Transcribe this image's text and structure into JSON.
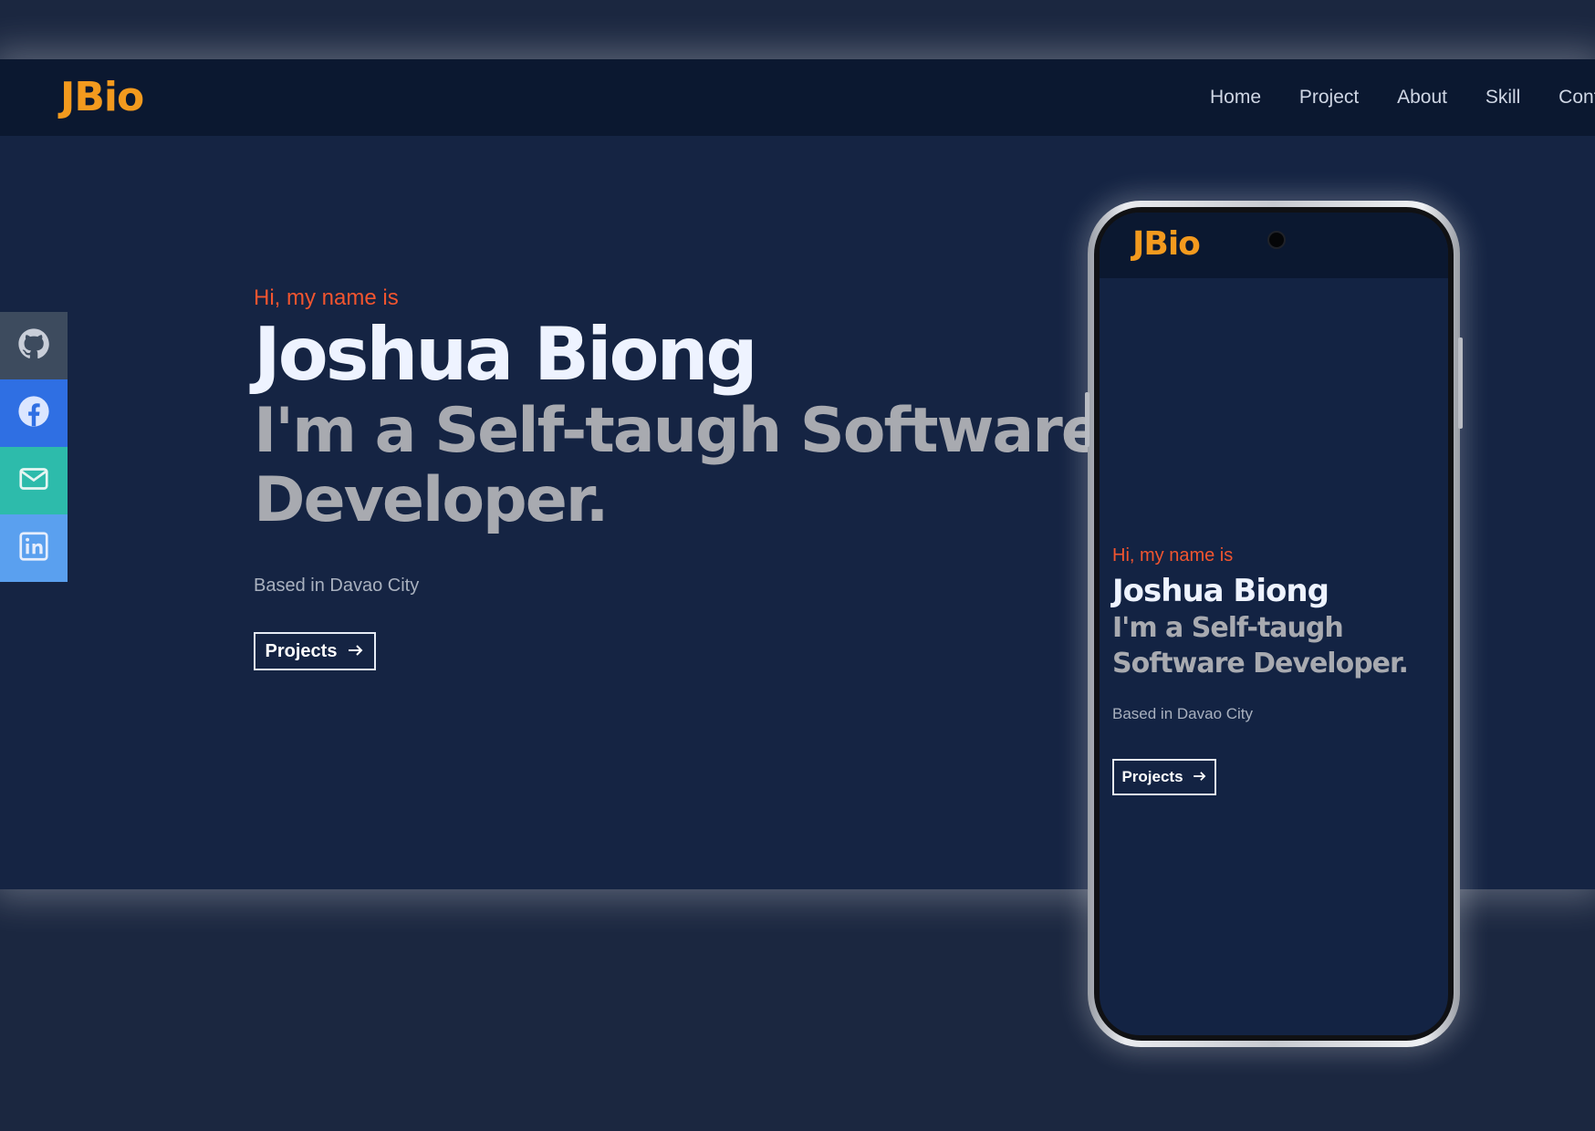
{
  "brand": {
    "logo": "JBio",
    "accent": "#f39a1e"
  },
  "nav": {
    "items": [
      "Home",
      "Project",
      "About",
      "Skill",
      "Cont"
    ]
  },
  "social": {
    "items": [
      {
        "icon": "github-icon",
        "color": "#3d4b5e"
      },
      {
        "icon": "facebook-icon",
        "color": "#2f6fe3"
      },
      {
        "icon": "mail-icon",
        "color": "#2dbbab"
      },
      {
        "icon": "linkedin-icon",
        "color": "#5aa0ef"
      }
    ]
  },
  "hero": {
    "greeting": "Hi, my name is",
    "name": "Joshua Biong",
    "tagline": "I'm a Self-taugh Software Developer.",
    "location": "Based in Davao City",
    "cta_label": "Projects",
    "cta_icon": "arrow-right-icon"
  },
  "phone": {
    "logo": "JBio",
    "greeting": "Hi, my name is",
    "name": "Joshua Biong",
    "tagline": "I'm a Self-taugh Software Developer.",
    "location": "Based in Davao City",
    "cta_label": "Projects"
  },
  "colors": {
    "background": "#152443",
    "greeting": "#f2552f",
    "name": "#eef3ff",
    "tagline": "#a8aab0"
  }
}
